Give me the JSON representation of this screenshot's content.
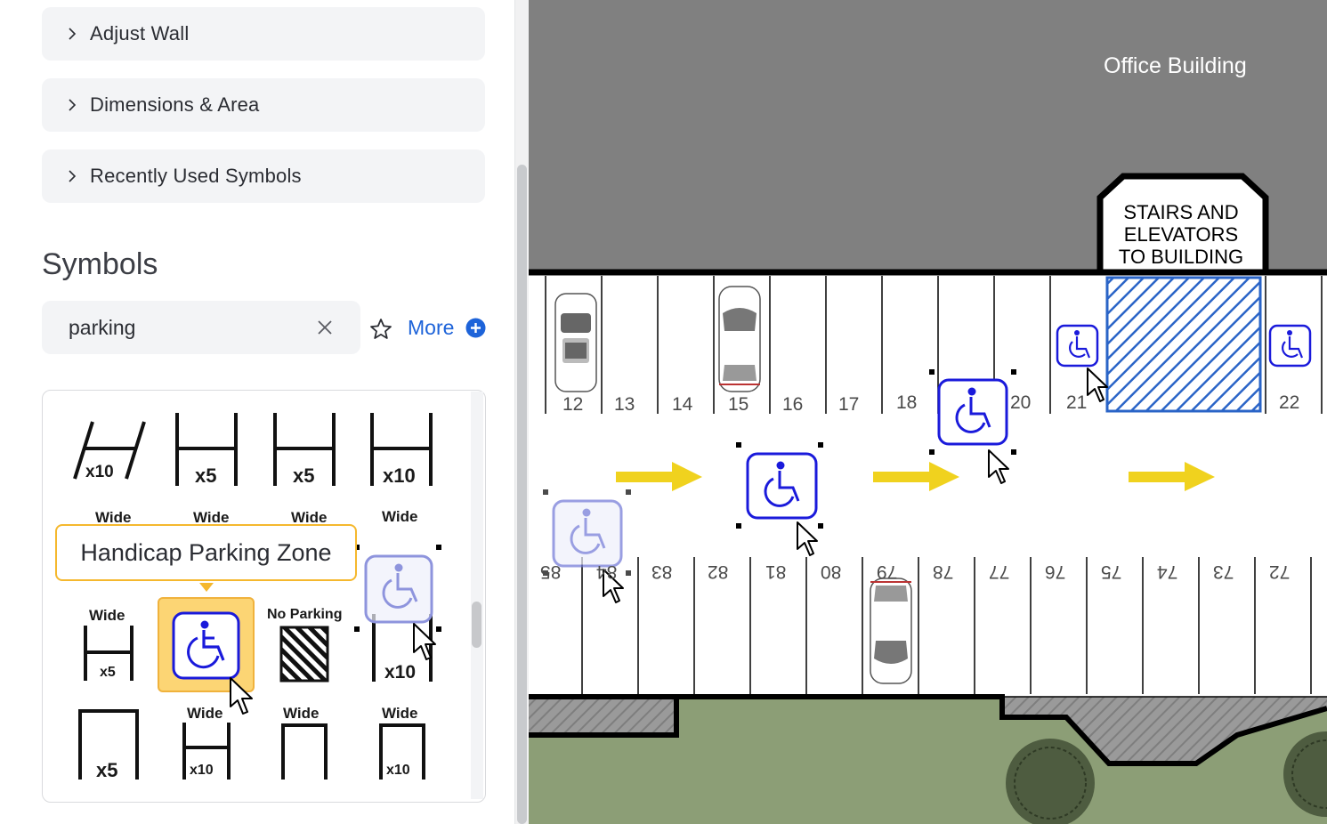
{
  "sidebar": {
    "accordions": [
      {
        "label": "Adjust Wall"
      },
      {
        "label": "Dimensions & Area"
      },
      {
        "label": "Recently Used Symbols"
      }
    ],
    "symbols_heading": "Symbols",
    "search": {
      "value": "parking",
      "placeholder": ""
    },
    "more_label": "More",
    "tooltip": "Handicap Parking Zone",
    "symbol_grid": {
      "row1": [
        "x10",
        "x5",
        "x5",
        "x10"
      ],
      "row2_captions": [
        "Wide",
        "Wide",
        "Wide",
        "Wide"
      ],
      "row3_wide": "Wide",
      "row3_wide_count": "x5",
      "row3_no_parking": "No Parking",
      "row3_last_count": "x10",
      "row4": [
        {
          "caption": "",
          "count": "x5"
        },
        {
          "caption": "Wide",
          "count": "x10"
        },
        {
          "caption": "Wide",
          "count": ""
        },
        {
          "caption": "Wide",
          "count": "x10"
        }
      ]
    }
  },
  "canvas": {
    "building_label": "Office Building",
    "stairs_label": [
      "STAIRS AND",
      "ELEVATORS",
      "TO BUILDING"
    ],
    "top_stall_numbers": [
      "12",
      "13",
      "14",
      "15",
      "16",
      "17",
      "18",
      "20",
      "21",
      "22"
    ],
    "bottom_stall_numbers": [
      "85",
      "84",
      "83",
      "82",
      "81",
      "80",
      "79",
      "78",
      "77",
      "76",
      "75",
      "74",
      "73",
      "72"
    ]
  },
  "colors": {
    "accent_blue": "#1d63d9",
    "handicap_blue": "#1a1adb",
    "tooltip_border": "#f5b82e",
    "selected_tile": "#fcd574",
    "building_gray": "#808080",
    "lawn_green": "#8c9e76",
    "arrow_yellow": "#f0d21e"
  },
  "icons": [
    "chevron-right-icon",
    "clear-x-icon",
    "star-icon",
    "plus-circle-icon",
    "handicap-icon",
    "mouse-cursor-icon"
  ]
}
